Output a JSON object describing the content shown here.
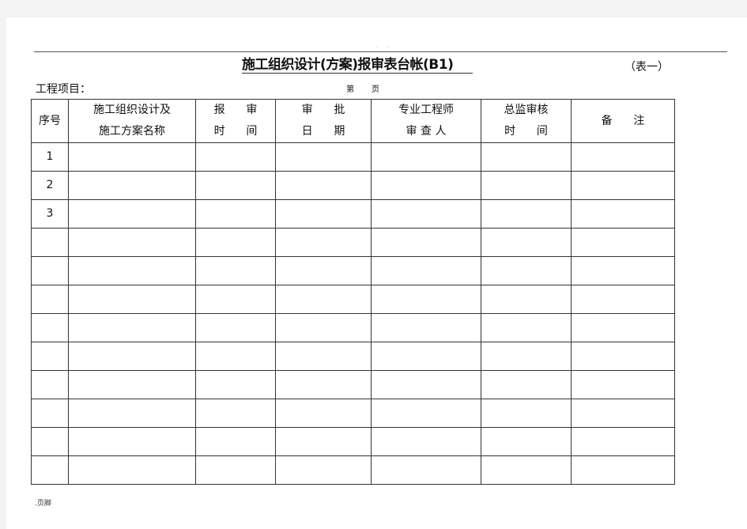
{
  "header": {
    "marker": ". .",
    "title": "施工组织设计(方案)报审表台帐(B1)",
    "table_tag": "（表一）",
    "project_label": "工程项目：",
    "page_prefix": "第",
    "page_suffix": "页"
  },
  "table": {
    "columns": [
      {
        "line1": "序号",
        "line2": ""
      },
      {
        "line1": "施工组织设计及",
        "line2": "施工方案名称"
      },
      {
        "line1": "报      审",
        "line2": "时      间"
      },
      {
        "line1": "审      批",
        "line2": "日      期"
      },
      {
        "line1": "专业工程师",
        "line2": "审 查 人"
      },
      {
        "line1": "总监审核",
        "line2": "时      间"
      },
      {
        "line1": "备      注",
        "line2": ""
      }
    ],
    "rows": [
      [
        "1",
        "",
        "",
        "",
        "",
        "",
        ""
      ],
      [
        "2",
        "",
        "",
        "",
        "",
        "",
        ""
      ],
      [
        "3",
        "",
        "",
        "",
        "",
        "",
        ""
      ],
      [
        "",
        "",
        "",
        "",
        "",
        "",
        ""
      ],
      [
        "",
        "",
        "",
        "",
        "",
        "",
        ""
      ],
      [
        "",
        "",
        "",
        "",
        "",
        "",
        ""
      ],
      [
        "",
        "",
        "",
        "",
        "",
        "",
        ""
      ],
      [
        "",
        "",
        "",
        "",
        "",
        "",
        ""
      ],
      [
        "",
        "",
        "",
        "",
        "",
        "",
        ""
      ],
      [
        "",
        "",
        "",
        "",
        "",
        "",
        ""
      ],
      [
        "",
        "",
        "",
        "",
        "",
        "",
        ""
      ],
      [
        "",
        "",
        "",
        "",
        "",
        "",
        ""
      ]
    ]
  },
  "footer": {
    "label": ".页脚"
  }
}
